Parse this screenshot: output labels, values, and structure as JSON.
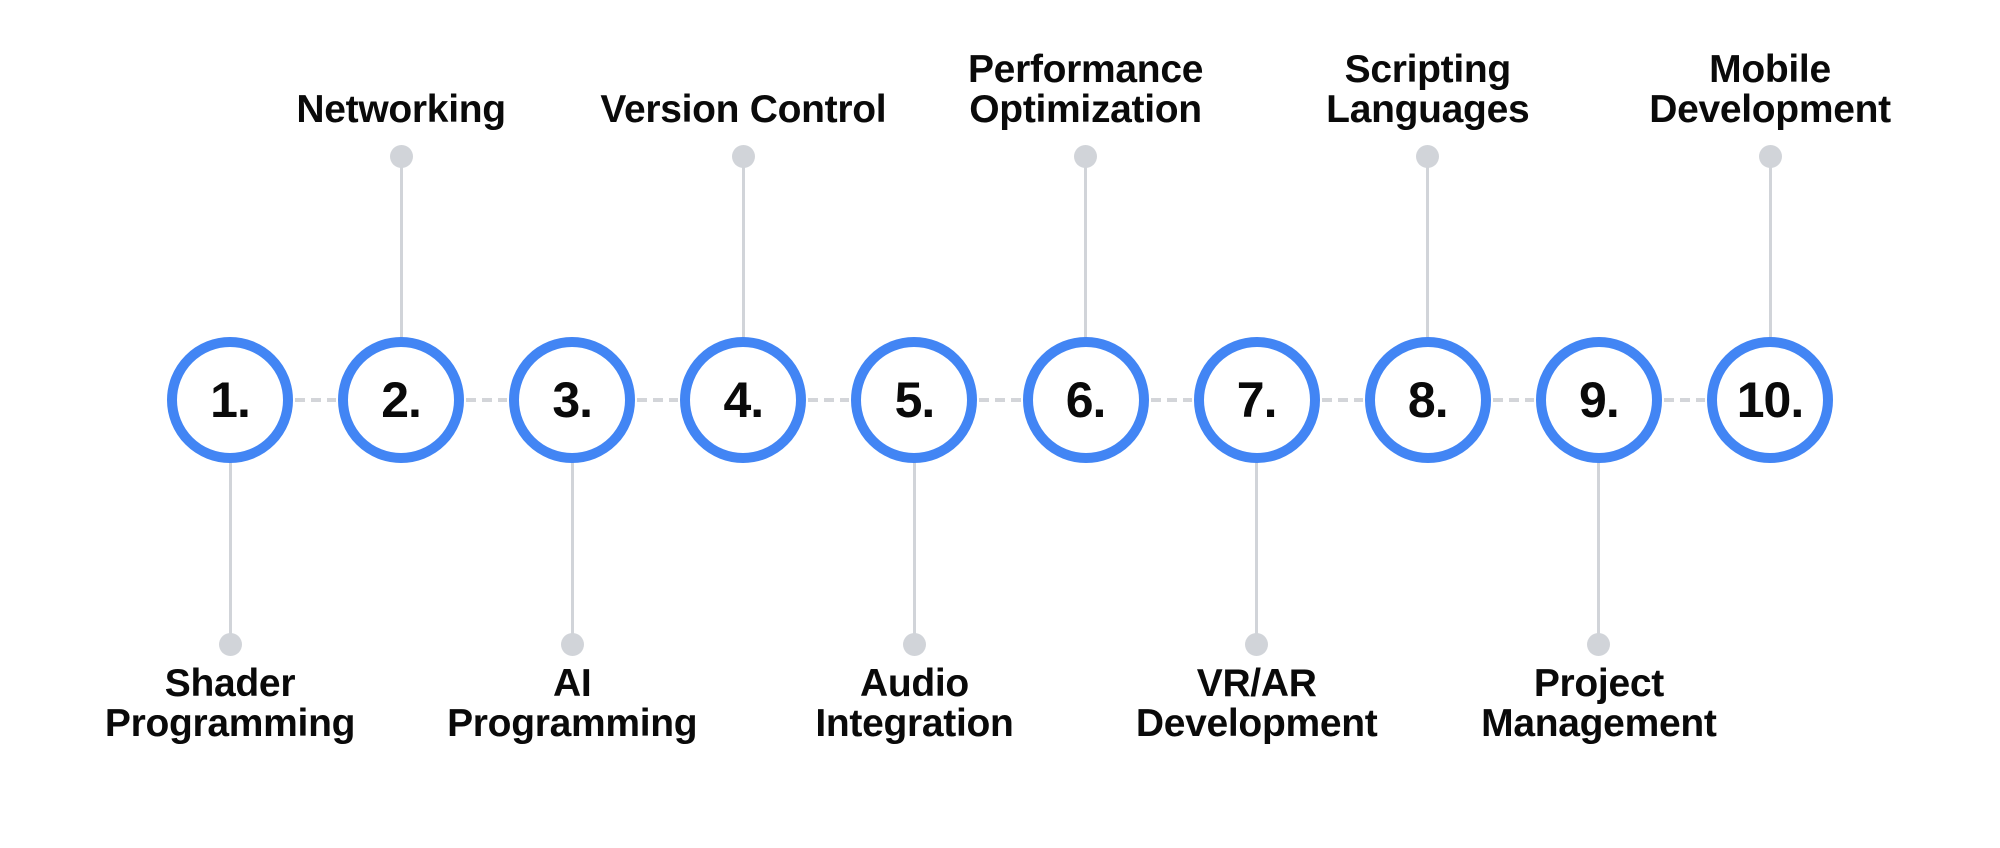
{
  "diagram": {
    "type": "numbered-timeline",
    "colors": {
      "ring": "#4285f4",
      "connector": "#d3d5d9",
      "text": "#0a0a0a",
      "background": "#ffffff"
    },
    "steps": [
      {
        "number": "1.",
        "label_lines": [
          "Shader",
          "Programming"
        ],
        "label_position": "below"
      },
      {
        "number": "2.",
        "label_lines": [
          "Networking"
        ],
        "label_position": "above"
      },
      {
        "number": "3.",
        "label_lines": [
          "AI",
          "Programming"
        ],
        "label_position": "below"
      },
      {
        "number": "4.",
        "label_lines": [
          "Version Control"
        ],
        "label_position": "above"
      },
      {
        "number": "5.",
        "label_lines": [
          "Audio",
          "Integration"
        ],
        "label_position": "below"
      },
      {
        "number": "6.",
        "label_lines": [
          "Performance",
          "Optimization"
        ],
        "label_position": "above"
      },
      {
        "number": "7.",
        "label_lines": [
          "VR/AR",
          "Development"
        ],
        "label_position": "below"
      },
      {
        "number": "8.",
        "label_lines": [
          "Scripting",
          "Languages"
        ],
        "label_position": "above"
      },
      {
        "number": "9.",
        "label_lines": [
          "Project",
          "Management"
        ],
        "label_position": "below"
      },
      {
        "number": "10.",
        "label_lines": [
          "Mobile",
          "Development"
        ],
        "label_position": "above"
      }
    ]
  }
}
